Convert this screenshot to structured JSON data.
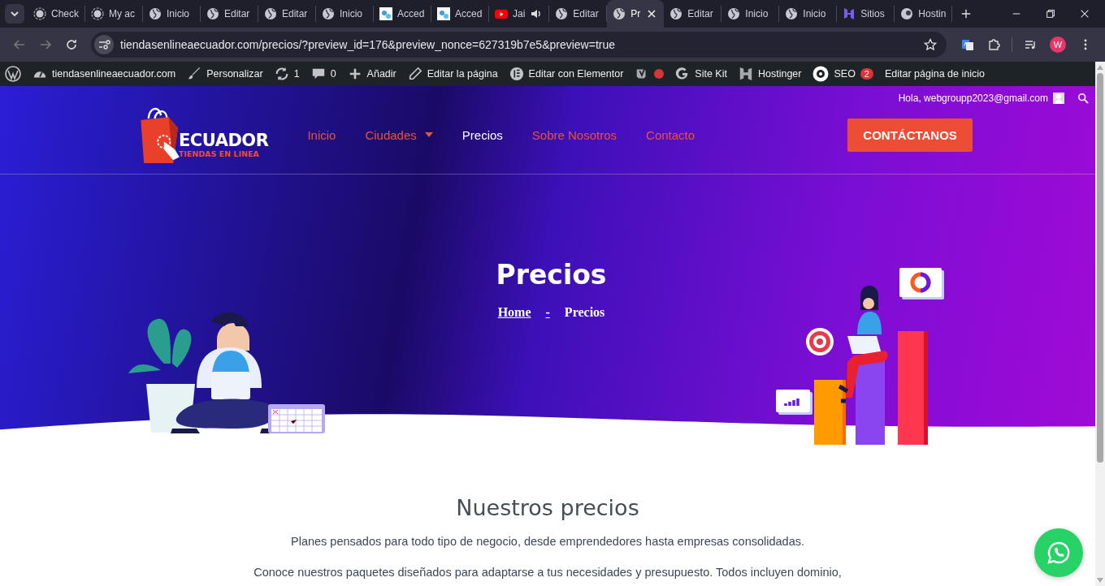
{
  "browser": {
    "tabs": [
      {
        "title": "Check",
        "kind": "ring",
        "selected": false,
        "audio": false
      },
      {
        "title": "My ac",
        "kind": "ring",
        "selected": false,
        "audio": false
      },
      {
        "title": "Inicio",
        "kind": "globe",
        "selected": false,
        "audio": false
      },
      {
        "title": "Editar",
        "kind": "globe",
        "selected": false,
        "audio": false
      },
      {
        "title": "Editar",
        "kind": "globe",
        "selected": false,
        "audio": false
      },
      {
        "title": "Inicio",
        "kind": "globe",
        "selected": false,
        "audio": false
      },
      {
        "title": "Acced",
        "kind": "app",
        "selected": false,
        "audio": false
      },
      {
        "title": "Acced",
        "kind": "app",
        "selected": false,
        "audio": false
      },
      {
        "title": "Jai",
        "kind": "video",
        "selected": false,
        "audio": true
      },
      {
        "title": "Editar",
        "kind": "globe",
        "selected": false,
        "audio": false
      },
      {
        "title": "Pr",
        "kind": "globe",
        "selected": true,
        "audio": false
      },
      {
        "title": "Editar",
        "kind": "globe",
        "selected": false,
        "audio": false
      },
      {
        "title": "Inicio",
        "kind": "globe",
        "selected": false,
        "audio": false
      },
      {
        "title": "Inicio",
        "kind": "globe",
        "selected": false,
        "audio": false
      },
      {
        "title": "Sitios",
        "kind": "h",
        "selected": false,
        "audio": false
      },
      {
        "title": "Hostin",
        "kind": "hosting",
        "selected": false,
        "audio": false
      }
    ],
    "url": "tiendasenlineaecuador.com/precios/?preview_id=176&preview_nonce=627319b7e5&preview=true",
    "profile_initial": "W"
  },
  "admin_bar": [
    {
      "kind": "wordpress"
    },
    {
      "kind": "dashboard",
      "label": "tiendasenlineaecuador.com"
    },
    {
      "kind": "brush",
      "label": "Personalizar"
    },
    {
      "kind": "refresh",
      "label": "1"
    },
    {
      "kind": "comment",
      "label": "0"
    },
    {
      "kind": "plus",
      "label": "Añadir"
    },
    {
      "kind": "pencil",
      "label": "Editar la página"
    },
    {
      "kind": "elementor",
      "label": "Editar con Elementor"
    },
    {
      "kind": "yoast",
      "color": "#d63638"
    },
    {
      "kind": "google",
      "label": "Site Kit"
    },
    {
      "kind": "hostinger",
      "label": "Hostinger"
    },
    {
      "kind": "seo",
      "label": "SEO",
      "badge": "2"
    },
    {
      "kind": "text",
      "label": "Editar página de inicio"
    }
  ],
  "site": {
    "greeting": "Hola, webgroupp2023@gmail.com",
    "logo": {
      "title": "ECUADOR",
      "subtitle": "TIENDAS EN LINEA"
    },
    "nav": [
      {
        "label": "Inicio",
        "selected": false,
        "dropdown": false
      },
      {
        "label": "Ciudades",
        "selected": false,
        "dropdown": true
      },
      {
        "label": "Precios",
        "selected": true,
        "dropdown": false
      },
      {
        "label": "Sobre Nosotros",
        "selected": false,
        "dropdown": false
      },
      {
        "label": "Contacto",
        "selected": false,
        "dropdown": false
      }
    ],
    "cta": "CONTÁCTANOS",
    "hero": {
      "title": "Precios",
      "breadcrumb": [
        {
          "label": "Home",
          "link": true
        },
        {
          "label": "-",
          "link": true
        },
        {
          "label": "Precios",
          "link": false
        }
      ]
    },
    "section": {
      "title": "Nuestros precios",
      "paragraphs": [
        "Planes pensados para todo tipo de negocio, desde emprendedores hasta empresas consolidadas.",
        "Conoce nuestros paquetes diseñados para adaptarse a tus necesidades y presupuesto. Todos incluyen dominio,"
      ]
    }
  }
}
